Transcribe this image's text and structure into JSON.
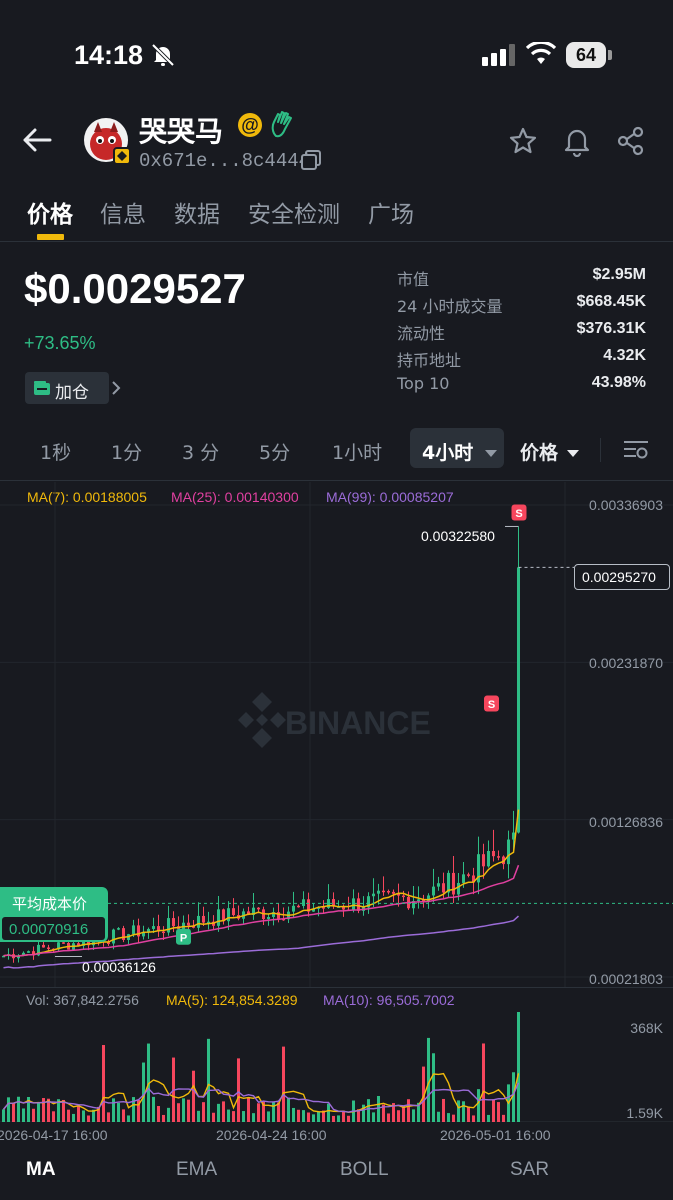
{
  "status_bar": {
    "time": "14:18",
    "battery": "64"
  },
  "header": {
    "token_name": "哭哭马",
    "address": "0x671e...8c4444"
  },
  "tabs": [
    {
      "label": "价格"
    },
    {
      "label": "信息"
    },
    {
      "label": "数据"
    },
    {
      "label": "安全检测"
    },
    {
      "label": "广场"
    }
  ],
  "price": {
    "value": "$0.0029527",
    "change": "+73.65%",
    "add_position": "加仓"
  },
  "stats": [
    {
      "label": "市值",
      "value": "$2.95M"
    },
    {
      "label": "24 小时成交量",
      "value": "$668.45K"
    },
    {
      "label": "流动性",
      "value": "$376.31K"
    },
    {
      "label": "持币地址",
      "value": "4.32K"
    },
    {
      "label": "Top 10",
      "value": "43.98%"
    }
  ],
  "timeframes": [
    {
      "label": "1秒"
    },
    {
      "label": "1分"
    },
    {
      "label": "3 分"
    },
    {
      "label": "5分"
    },
    {
      "label": "1小时"
    },
    {
      "label": "4小时"
    }
  ],
  "price_mode": "价格",
  "colors": {
    "up": "#2ebd85",
    "down": "#f6465d",
    "accent": "#f0b90b",
    "ma7": "#f0b90b",
    "ma25": "#e040a0",
    "ma99": "#9b6cd8"
  },
  "chart_indicators": {
    "ma7": "MA(7): 0.00188005",
    "ma25": "MA(25): 0.00140300",
    "ma99": "MA(99): 0.00085207"
  },
  "chart_data": {
    "type": "candlestick",
    "watermark": "BINANCE",
    "y_ticks": [
      "0.00336903",
      "0.00231870",
      "0.00126836",
      "0.00021803"
    ],
    "ylim": [
      0.00021803,
      0.00336903
    ],
    "high_label": "0.00322580",
    "low_label": "0.00036126",
    "current_label": "0.00295270",
    "avg_cost_title": "平均成本价",
    "avg_cost_value": "0.00070916",
    "avg_cost": 0.00070916,
    "current": 0.0029527,
    "high": 0.0032258,
    "low": 0.00036126,
    "x_labels": [
      "2026-04-17 16:00",
      "2026-04-24 16:00",
      "2026-05-01 16:00"
    ],
    "markers": [
      {
        "label": "S",
        "price": 0.0032258
      },
      {
        "label": "S",
        "price": 0.00195
      },
      {
        "label": "P",
        "price": 0.00058
      }
    ]
  },
  "volume": {
    "vol": "Vol: 367,842.2756",
    "ma5": "MA(5): 124,854.3289",
    "ma10": "MA(10): 96,505.7002",
    "y_ticks": [
      "368K",
      "1.59K"
    ]
  },
  "bottom_tabs": [
    {
      "label": "MA"
    },
    {
      "label": "EMA"
    },
    {
      "label": "BOLL"
    },
    {
      "label": "SAR"
    }
  ]
}
